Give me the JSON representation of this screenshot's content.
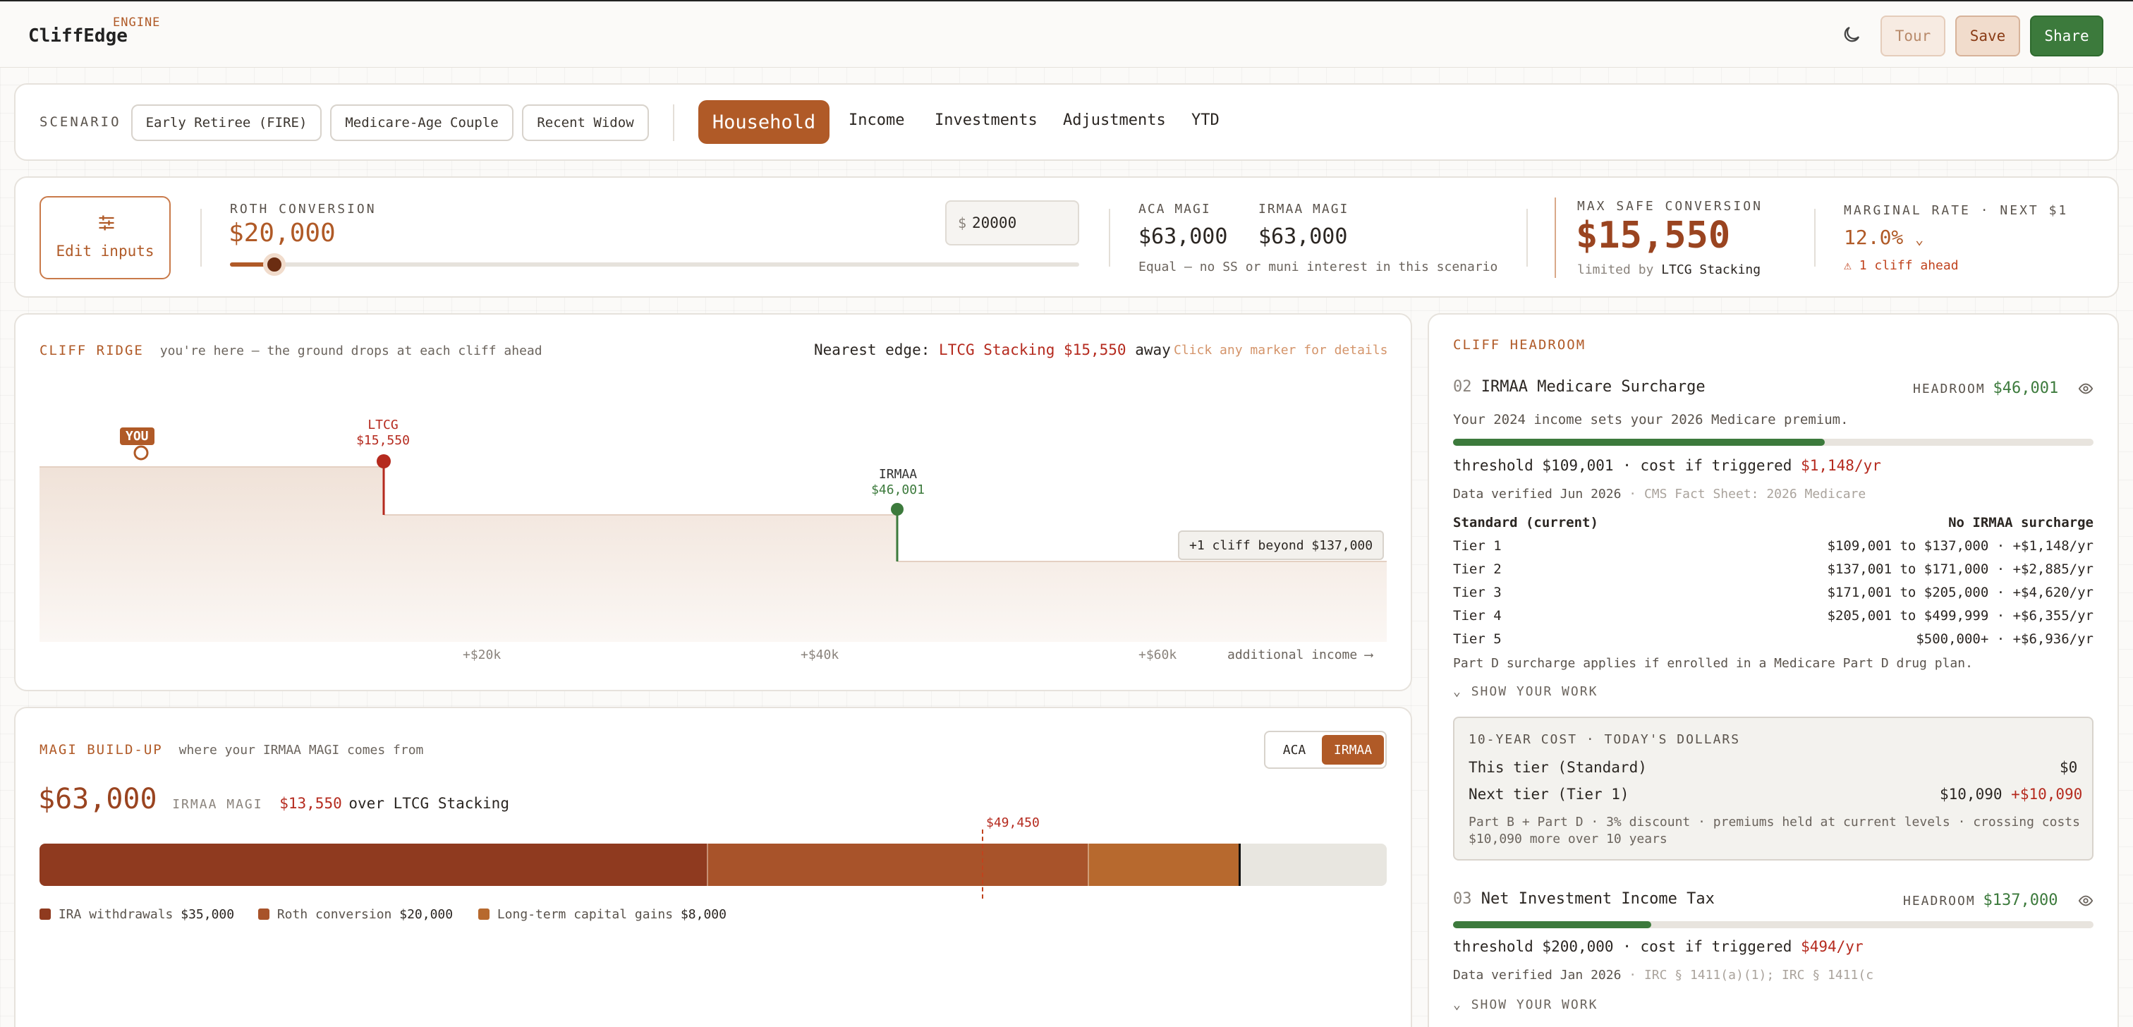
{
  "app": {
    "name": "CliffEdge",
    "badge": "ENGINE"
  },
  "top_actions": {
    "tour": "Tour",
    "save": "Save",
    "share": "Share"
  },
  "scenario": {
    "label": "SCENARIO",
    "presets": [
      "Early Retiree (FIRE)",
      "Medicare-Age Couple",
      "Recent Widow"
    ],
    "tabs": [
      "Household",
      "Income",
      "Investments",
      "Adjustments",
      "YTD"
    ],
    "active_tab": "Household"
  },
  "controls": {
    "edit_inputs": "Edit inputs",
    "roth_label": "ROTH CONVERSION",
    "roth_value": "$20,000",
    "roth_fraction": 0.052,
    "input_prefix": "$",
    "input_value": "20000",
    "aca_label": "ACA MAGI",
    "aca_value": "$63,000",
    "irmaa_label": "IRMAA MAGI",
    "irmaa_value": "$63,000",
    "magi_note": "Equal — no SS or muni interest in this scenario",
    "max_safe_label": "MAX SAFE CONVERSION",
    "max_safe_value": "$15,550",
    "limited_by_prefix": "limited by",
    "limited_by": "LTCG Stacking",
    "marginal_label": "MARGINAL RATE · NEXT $1",
    "marginal_value": "12.0%",
    "cliff_ahead": "1 cliff ahead"
  },
  "ridge": {
    "title": "CLIFF RIDGE",
    "subtitle": "you're here — the ground drops at each cliff ahead",
    "nearest_label": "Nearest edge:",
    "nearest_value": "LTCG Stacking $15,550",
    "nearest_suffix": "away",
    "hint": "Click any marker for details",
    "you_label": "YOU",
    "markers": [
      {
        "name": "LTCG",
        "value": "$15,550",
        "color": "#b52a1e"
      },
      {
        "name": "IRMAA",
        "value": "$46,001",
        "color": "#3c7a3c"
      }
    ],
    "beyond": "+1 cliff beyond $137,000",
    "axis": [
      "+$20k",
      "+$40k",
      "+$60k"
    ],
    "axis_label": "additional income ⟶"
  },
  "magi": {
    "title": "MAGI BUILD-UP",
    "subtitle": "where your IRMAA MAGI comes from",
    "toggle": [
      "ACA",
      "IRMAA"
    ],
    "active_toggle": "IRMAA",
    "total": "$63,000",
    "total_label": "IRMAA MAGI",
    "over_value": "$13,550",
    "over_suffix": "over LTCG Stacking",
    "marker": "$49,450",
    "segments": [
      {
        "label": "IRA withdrawals",
        "value": "$35,000",
        "amount": 35000,
        "color": "#8f3a1f"
      },
      {
        "label": "Roth conversion",
        "value": "$20,000",
        "amount": 20000,
        "color": "#a8532a"
      },
      {
        "label": "Long-term capital gains",
        "value": "$8,000",
        "amount": 8000,
        "color": "#b7692e"
      }
    ],
    "scale_max": 70700,
    "marker_amount": 49450
  },
  "headroom": {
    "title": "CLIFF HEADROOM",
    "headroom_label": "HEADROOM",
    "cards": [
      {
        "num": "02",
        "name": "IRMAA Medicare Surcharge",
        "headroom": "$46,001",
        "progress": 0.58,
        "desc": "Your 2024 income sets your 2026 Medicare premium.",
        "threshold": "threshold $109,001 · cost if triggered",
        "cost": "$1,148/yr",
        "verified": "Data verified Jun 2026",
        "source": "· CMS Fact Sheet: 2026 Medicare"
      },
      {
        "num": "03",
        "name": "Net Investment Income Tax",
        "headroom": "$137,000",
        "progress": 0.31,
        "threshold": "threshold $200,000 · cost if triggered",
        "cost": "$494/yr",
        "verified": "Data verified Jan 2026",
        "source": "· IRC § 1411(a)(1); IRC § 1411(c"
      }
    ],
    "tiers": [
      {
        "name": "Standard (current)",
        "range": "No IRMAA surcharge"
      },
      {
        "name": "Tier 1",
        "range": "$109,001 to $137,000 · +$1,148/yr"
      },
      {
        "name": "Tier 2",
        "range": "$137,001 to $171,000 · +$2,885/yr"
      },
      {
        "name": "Tier 3",
        "range": "$171,001 to $205,000 · +$4,620/yr"
      },
      {
        "name": "Tier 4",
        "range": "$205,001 to $499,999 · +$6,355/yr"
      },
      {
        "name": "Tier 5",
        "range": "$500,000+ · +$6,936/yr"
      }
    ],
    "part_d_note": "Part D surcharge applies if enrolled in a Medicare Part D drug plan.",
    "show_work": "SHOW YOUR WORK",
    "tenyear": {
      "title": "10-YEAR COST · TODAY'S DOLLARS",
      "this_tier": "This tier (Standard)",
      "this_value": "$0",
      "next_tier": "Next tier (Tier 1)",
      "next_value": "$10,090",
      "next_delta": "+$10,090",
      "note": "Part B + Part D · 3% discount · premiums held at current levels · crossing costs $10,090 more over 10 years"
    }
  }
}
